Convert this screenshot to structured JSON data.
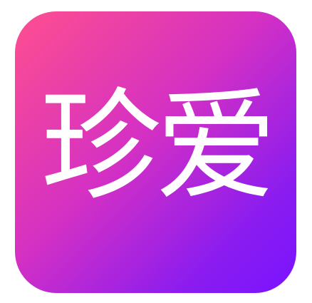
{
  "app_icon": {
    "logo_text": "珍爱"
  },
  "colors": {
    "gradient_start": "#ff4f8f",
    "gradient_mid": "#d430c4",
    "gradient_end": "#7a12ff",
    "text": "#ffffff"
  }
}
